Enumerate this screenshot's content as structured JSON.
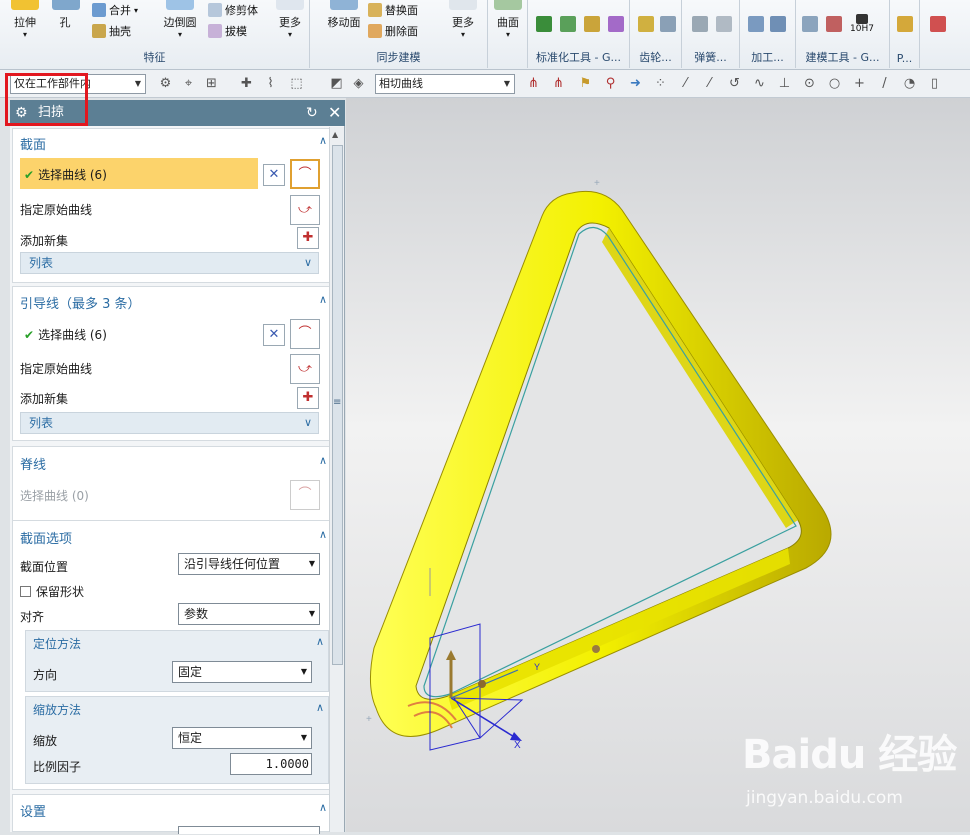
{
  "ribbon": {
    "groups": [
      {
        "label": "特征",
        "buttons": [
          "拉伸",
          "孔",
          "合并",
          "抽壳",
          "边倒圆",
          "修剪体",
          "拔模",
          "更多"
        ]
      },
      {
        "label": "同步建模",
        "buttons": [
          "移动面",
          "替换面",
          "删除面",
          "更多"
        ]
      },
      {
        "label": "",
        "buttons": [
          "曲面"
        ]
      },
      {
        "label": "标准化工具 - G...",
        "buttons": []
      },
      {
        "label": "齿轮...",
        "buttons": []
      },
      {
        "label": "弹簧...",
        "buttons": []
      },
      {
        "label": "加工...",
        "buttons": []
      },
      {
        "label": "建模工具 - G...",
        "buttons": [
          "10H7"
        ]
      },
      {
        "label": "P...",
        "buttons": []
      }
    ]
  },
  "toolbar2": {
    "filter_combo": "仅在工作部件内",
    "curve_rule_combo": "相切曲线"
  },
  "dialog": {
    "title": "扫掠",
    "sections": {
      "section": {
        "title": "截面",
        "select_curve": "选择曲线 (6)",
        "specify_origin": "指定原始曲线",
        "add_new_set": "添加新集",
        "list": "列表"
      },
      "guide": {
        "title": "引导线（最多 3 条）",
        "select_curve": "选择曲线 (6)",
        "specify_origin": "指定原始曲线",
        "add_new_set": "添加新集",
        "list": "列表"
      },
      "spine": {
        "title": "脊线",
        "select_curve": "选择曲线 (0)"
      },
      "options": {
        "title": "截面选项",
        "position_label": "截面位置",
        "position_value": "沿引导线任何位置",
        "preserve_shape": "保留形状",
        "align_label": "对齐",
        "align_value": "参数",
        "orientation": {
          "title": "定位方法",
          "dir_label": "方向",
          "dir_value": "固定"
        },
        "scaling": {
          "title": "缩放方法",
          "scale_label": "缩放",
          "scale_value": "恒定",
          "factor_label": "比例因子",
          "factor_value": "1.0000"
        }
      },
      "settings": {
        "title": "设置"
      }
    }
  },
  "viewport": {
    "axis_x": "X",
    "axis_y": "Y",
    "model_color": "#ffff00"
  },
  "watermark": {
    "brand": "Baidu 经验",
    "url": "jingyan.baidu.com"
  }
}
